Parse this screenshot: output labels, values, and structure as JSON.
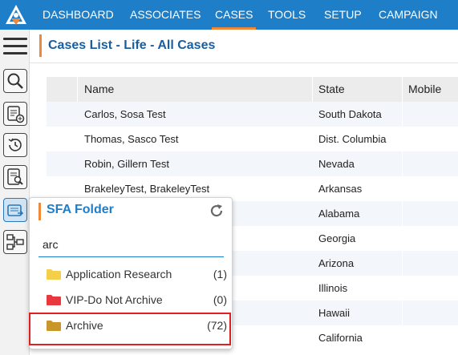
{
  "nav": {
    "logo_icon": "app-logo-icon",
    "items": [
      {
        "label": "DASHBOARD"
      },
      {
        "label": "ASSOCIATES"
      },
      {
        "label": "CASES",
        "active": true
      },
      {
        "label": "TOOLS"
      },
      {
        "label": "SETUP"
      },
      {
        "label": "CAMPAIGN"
      }
    ],
    "bg_color": "#1e7ec8",
    "active_underline_color": "#f0883a"
  },
  "sidebar": {
    "icons": [
      "menu-icon",
      "search-icon",
      "new-document-icon",
      "history-icon",
      "document-search-icon",
      "sfa-folder-icon",
      "workflow-icon"
    ]
  },
  "page": {
    "title": "Cases List - Life - All Cases"
  },
  "table": {
    "columns": [
      "Name",
      "State",
      "Mobile"
    ],
    "rows": [
      {
        "name": "Carlos, Sosa Test",
        "state": "South Dakota"
      },
      {
        "name": "Thomas, Sasco Test",
        "state": "Dist. Columbia"
      },
      {
        "name": "Robin, Gillern Test",
        "state": "Nevada"
      },
      {
        "name": "BrakeleyTest, BrakeleyTest",
        "state": "Arkansas"
      },
      {
        "name": "",
        "state": "Alabama"
      },
      {
        "name": "",
        "state": "Georgia"
      },
      {
        "name": "",
        "state": "Arizona"
      },
      {
        "name": "",
        "state": "Illinois"
      },
      {
        "name": "",
        "state": "Hawaii"
      },
      {
        "name": "",
        "state": "California"
      }
    ]
  },
  "sfa_folder": {
    "title": "SFA Folder",
    "refresh_icon": "refresh-icon",
    "search_value": "arc",
    "folders": [
      {
        "label": "Application Research",
        "count": "(1)",
        "icon": "folder-icon",
        "color": "#f5cf4a"
      },
      {
        "label": "VIP-Do Not Archive",
        "count": "(0)",
        "icon": "folder-icon",
        "color": "#e8383d"
      },
      {
        "label": "Archive",
        "count": "(72)",
        "icon": "folder-icon",
        "color": "#c9962a"
      }
    ],
    "highlight_color": "#e02020"
  }
}
